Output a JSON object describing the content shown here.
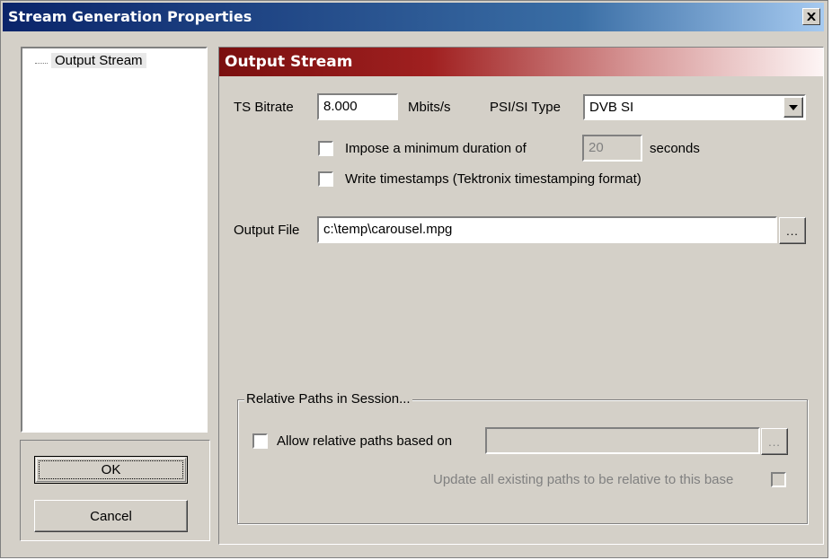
{
  "window": {
    "title": "Stream Generation Properties",
    "close_label": "✕"
  },
  "tree": {
    "items": [
      {
        "label": "Output Stream"
      }
    ]
  },
  "buttons": {
    "ok_label": "OK",
    "cancel_label": "Cancel"
  },
  "section": {
    "title": "Output Stream"
  },
  "form": {
    "ts_bitrate_label": "TS Bitrate",
    "ts_bitrate_value": "8.000",
    "ts_bitrate_unit": "Mbits/s",
    "psi_si_label": "PSI/SI Type",
    "psi_si_value": "DVB SI",
    "min_duration_label": "Impose a minimum duration of",
    "min_duration_checked": false,
    "min_duration_value": "20",
    "min_duration_unit": "seconds",
    "timestamps_label": "Write timestamps (Tektronix timestamping format)",
    "timestamps_checked": false,
    "output_file_label": "Output File",
    "output_file_value": "c:\\temp\\carousel.mpg",
    "browse_label": "..."
  },
  "relative_paths": {
    "group_title": "Relative Paths in Session...",
    "allow_label": "Allow relative paths based on",
    "allow_checked": false,
    "base_path_value": "",
    "browse_label": "...",
    "update_label": "Update all existing paths to be relative to this base",
    "update_checked": false
  }
}
